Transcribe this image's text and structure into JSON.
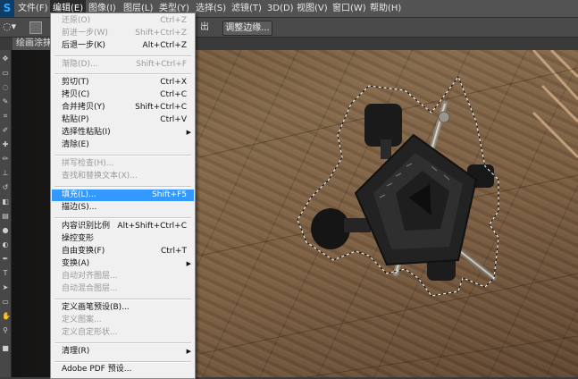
{
  "app": {
    "logo": "S"
  },
  "menubar": {
    "items": [
      {
        "label": "文件(F)"
      },
      {
        "label": "编辑(E)"
      },
      {
        "label": "图像(I)"
      },
      {
        "label": "图层(L)"
      },
      {
        "label": "类型(Y)"
      },
      {
        "label": "选择(S)"
      },
      {
        "label": "滤镜(T)"
      },
      {
        "label": "3D(D)"
      },
      {
        "label": "视图(V)"
      },
      {
        "label": "窗口(W)"
      },
      {
        "label": "帮助(H)"
      }
    ],
    "active": "编辑(E)"
  },
  "options_bar": {
    "output_label": "出",
    "refine_edge_label": "调整边缘..."
  },
  "document": {
    "tab_label": "绘画涂抹"
  },
  "edit_menu": {
    "items": [
      {
        "label": "还原(O)",
        "shortcut": "Ctrl+Z",
        "disabled": true
      },
      {
        "label": "前进一步(W)",
        "shortcut": "Shift+Ctrl+Z",
        "disabled": true
      },
      {
        "label": "后退一步(K)",
        "shortcut": "Alt+Ctrl+Z",
        "disabled": false
      },
      {
        "label": "渐隐(D)...",
        "shortcut": "Shift+Ctrl+F",
        "disabled": true
      },
      {
        "label": "剪切(T)",
        "shortcut": "Ctrl+X",
        "disabled": false
      },
      {
        "label": "拷贝(C)",
        "shortcut": "Ctrl+C",
        "disabled": false
      },
      {
        "label": "合并拷贝(Y)",
        "shortcut": "Shift+Ctrl+C",
        "disabled": false
      },
      {
        "label": "粘贴(P)",
        "shortcut": "Ctrl+V",
        "disabled": false
      },
      {
        "label": "选择性粘贴(I)",
        "shortcut": "",
        "submenu": true,
        "disabled": false
      },
      {
        "label": "清除(E)",
        "shortcut": "",
        "disabled": false
      },
      {
        "label": "拼写检查(H)...",
        "shortcut": "",
        "disabled": true
      },
      {
        "label": "查找和替换文本(X)...",
        "shortcut": "",
        "disabled": true
      },
      {
        "label": "填充(L)...",
        "shortcut": "Shift+F5",
        "disabled": false,
        "selected": true
      },
      {
        "label": "描边(S)...",
        "shortcut": "",
        "disabled": false
      },
      {
        "label": "内容识别比例",
        "shortcut": "Alt+Shift+Ctrl+C",
        "disabled": false
      },
      {
        "label": "操控变形",
        "shortcut": "",
        "disabled": false
      },
      {
        "label": "自由变换(F)",
        "shortcut": "Ctrl+T",
        "disabled": false
      },
      {
        "label": "变换(A)",
        "shortcut": "",
        "submenu": true,
        "disabled": false
      },
      {
        "label": "自动对齐图层...",
        "shortcut": "",
        "disabled": true
      },
      {
        "label": "自动混合图层...",
        "shortcut": "",
        "disabled": true
      },
      {
        "label": "定义画笔预设(B)...",
        "shortcut": "",
        "disabled": false
      },
      {
        "label": "定义图案...",
        "shortcut": "",
        "disabled": true
      },
      {
        "label": "定义自定形状...",
        "shortcut": "",
        "disabled": true
      },
      {
        "label": "清理(R)",
        "shortcut": "",
        "submenu": true,
        "disabled": false
      },
      {
        "label": "Adobe PDF 预设...",
        "shortcut": "",
        "disabled": false
      }
    ]
  },
  "colors": {
    "menu_highlight": "#3399ff",
    "menubar_bg": "#535353",
    "ps_blue": "#31a8ff"
  }
}
